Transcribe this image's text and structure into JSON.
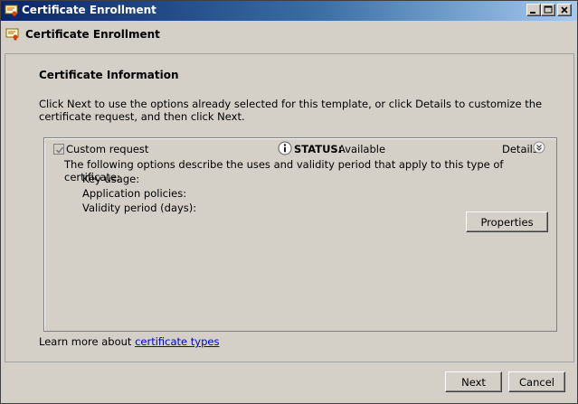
{
  "window": {
    "title": "Certificate Enrollment"
  },
  "header": {
    "title": "Certificate Enrollment"
  },
  "content": {
    "section_title": "Certificate Information",
    "intro": "Click Next to use the options already selected for this template, or click Details to customize the certificate request, and then click Next.",
    "panel": {
      "checkbox_label": "Custom request",
      "checkbox_checked": true,
      "status_label": "STATUS:",
      "status_value": "Available",
      "details_label": "Details",
      "description": "The following options describe the uses and validity period that apply to this type of certificate:",
      "key_usage_label": "Key usage:",
      "app_policies_label": "Application policies:",
      "validity_label": "Validity period (days):",
      "properties_button": "Properties"
    },
    "learn_more_prefix": "Learn more about",
    "learn_more_link": "certificate types"
  },
  "footer": {
    "next_label": "Next",
    "cancel_label": "Cancel"
  },
  "colors": {
    "face": "#d4d0c8",
    "title_start": "#0a246a",
    "title_end": "#a6caf0",
    "link": "#0000cc"
  },
  "icons": {
    "app": "certificate-icon",
    "status": "info-icon",
    "details": "chevron-down-circle-icon"
  }
}
